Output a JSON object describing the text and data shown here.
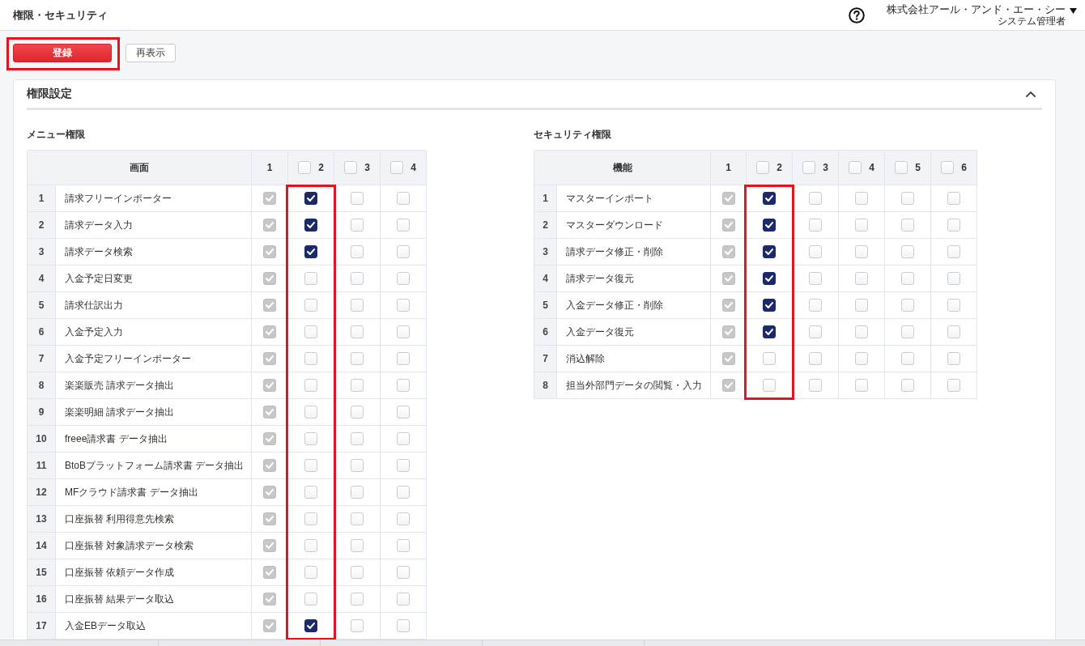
{
  "header": {
    "title": "権限・セキュリティ",
    "user": {
      "company": "株式会社アール・アンド・エー・シー",
      "role": "システム管理者"
    }
  },
  "toolbar": {
    "buttons": [
      {
        "label": "登録",
        "kind": "primary",
        "highlighted": true
      },
      {
        "label": "再表示",
        "kind": "secondary",
        "highlighted": false
      }
    ]
  },
  "panel": {
    "title": "権限設定",
    "expanded": true,
    "sections": [
      {
        "title": "メニュー権限",
        "name_header": "画面",
        "columns": [
          {
            "label": "1",
            "kind": "plain",
            "disabled": true,
            "highlighted": false
          },
          {
            "label": "2",
            "kind": "checkbox",
            "checked": false,
            "disabled": false,
            "highlighted": true
          },
          {
            "label": "3",
            "kind": "checkbox",
            "checked": false,
            "disabled": false,
            "highlighted": false
          },
          {
            "label": "4",
            "kind": "checkbox",
            "checked": false,
            "disabled": false,
            "highlighted": false
          }
        ],
        "rows": [
          {
            "no": "1",
            "name": "請求フリーインポーター",
            "checks": [
              true,
              true,
              false,
              false
            ]
          },
          {
            "no": "2",
            "name": "請求データ入力",
            "checks": [
              true,
              true,
              false,
              false
            ]
          },
          {
            "no": "3",
            "name": "請求データ検索",
            "checks": [
              true,
              true,
              false,
              false
            ]
          },
          {
            "no": "4",
            "name": "入金予定日変更",
            "checks": [
              true,
              false,
              false,
              false
            ]
          },
          {
            "no": "5",
            "name": "請求仕訳出力",
            "checks": [
              true,
              false,
              false,
              false
            ]
          },
          {
            "no": "6",
            "name": "入金予定入力",
            "checks": [
              true,
              false,
              false,
              false
            ]
          },
          {
            "no": "7",
            "name": "入金予定フリーインポーター",
            "checks": [
              true,
              false,
              false,
              false
            ]
          },
          {
            "no": "8",
            "name": "楽楽販売 請求データ抽出",
            "checks": [
              true,
              false,
              false,
              false
            ]
          },
          {
            "no": "9",
            "name": "楽楽明細 請求データ抽出",
            "checks": [
              true,
              false,
              false,
              false
            ]
          },
          {
            "no": "10",
            "name": "freee請求書 データ抽出",
            "checks": [
              true,
              false,
              false,
              false
            ]
          },
          {
            "no": "11",
            "name": "BtoBプラットフォーム請求書 データ抽出",
            "checks": [
              true,
              false,
              false,
              false
            ]
          },
          {
            "no": "12",
            "name": "MFクラウド請求書 データ抽出",
            "checks": [
              true,
              false,
              false,
              false
            ]
          },
          {
            "no": "13",
            "name": "口座振替 利用得意先検索",
            "checks": [
              true,
              false,
              false,
              false
            ]
          },
          {
            "no": "14",
            "name": "口座振替 対象請求データ検索",
            "checks": [
              true,
              false,
              false,
              false
            ]
          },
          {
            "no": "15",
            "name": "口座振替 依頼データ作成",
            "checks": [
              true,
              false,
              false,
              false
            ]
          },
          {
            "no": "16",
            "name": "口座振替 結果データ取込",
            "checks": [
              true,
              false,
              false,
              false
            ]
          },
          {
            "no": "17",
            "name": "入金EBデータ取込",
            "checks": [
              true,
              true,
              false,
              false
            ]
          }
        ]
      },
      {
        "title": "セキュリティ権限",
        "name_header": "機能",
        "columns": [
          {
            "label": "1",
            "kind": "plain",
            "disabled": true,
            "highlighted": false
          },
          {
            "label": "2",
            "kind": "checkbox",
            "checked": false,
            "disabled": false,
            "highlighted": true
          },
          {
            "label": "3",
            "kind": "checkbox",
            "checked": false,
            "disabled": false,
            "highlighted": false
          },
          {
            "label": "4",
            "kind": "checkbox",
            "checked": false,
            "disabled": false,
            "highlighted": false
          },
          {
            "label": "5",
            "kind": "checkbox",
            "checked": false,
            "disabled": false,
            "highlighted": false
          },
          {
            "label": "6",
            "kind": "checkbox",
            "checked": false,
            "disabled": false,
            "highlighted": false
          }
        ],
        "rows": [
          {
            "no": "1",
            "name": "マスターインポート",
            "checks": [
              true,
              true,
              false,
              false,
              false,
              false
            ]
          },
          {
            "no": "2",
            "name": "マスターダウンロード",
            "checks": [
              true,
              true,
              false,
              false,
              false,
              false
            ]
          },
          {
            "no": "3",
            "name": "請求データ修正・削除",
            "checks": [
              true,
              true,
              false,
              false,
              false,
              false
            ]
          },
          {
            "no": "4",
            "name": "請求データ復元",
            "checks": [
              true,
              true,
              false,
              false,
              false,
              false
            ]
          },
          {
            "no": "5",
            "name": "入金データ修正・削除",
            "checks": [
              true,
              true,
              false,
              false,
              false,
              false
            ]
          },
          {
            "no": "6",
            "name": "入金データ復元",
            "checks": [
              true,
              true,
              false,
              false,
              false,
              false
            ]
          },
          {
            "no": "7",
            "name": "消込解除",
            "checks": [
              true,
              false,
              false,
              false,
              false,
              false
            ]
          },
          {
            "no": "8",
            "name": "担当外部門データの閲覧・入力",
            "checks": [
              true,
              false,
              false,
              false,
              false,
              false
            ]
          }
        ]
      }
    ]
  }
}
